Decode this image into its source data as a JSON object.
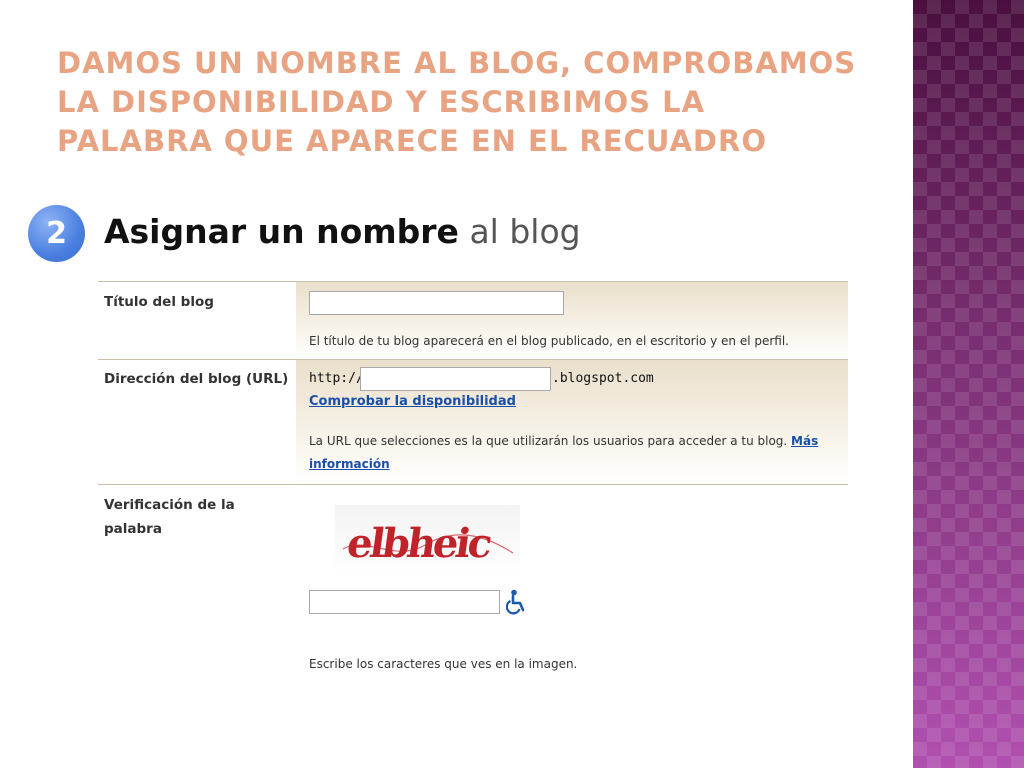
{
  "slide": {
    "title": "Damos un nombre al blog, comprobamos la disponibilidad y escribimos la palabra que aparece en el recuadro"
  },
  "step": {
    "number": "2",
    "heading_strong": "Asignar un nombre",
    "heading_light": "al blog"
  },
  "form": {
    "title_row": {
      "label": "Título del blog",
      "value": "",
      "hint": "El título de tu blog aparecerá en el blog publicado, en el escritorio y en el perfil."
    },
    "url_row": {
      "label": "Dirección del blog (URL)",
      "prefix": "http://",
      "value": "",
      "suffix": ".blogspot.com",
      "check_link": "Comprobar la disponibilidad",
      "hint": "La URL que selecciones es la que utilizarán los usuarios para acceder a tu blog.",
      "more_link": "Más información"
    },
    "captcha_row": {
      "label": "Verificación de la palabra",
      "captcha_text": "elbheic",
      "value": "",
      "hint": "Escribe los caracteres que ves en la imagen."
    }
  },
  "colors": {
    "title": "#e8a382",
    "badge": "#4a7fe0",
    "link": "#1a4fa8",
    "captcha": "#c0242a",
    "side_band": "#8c3a8c"
  },
  "icons": {
    "accessibility": "wheelchair-icon"
  }
}
